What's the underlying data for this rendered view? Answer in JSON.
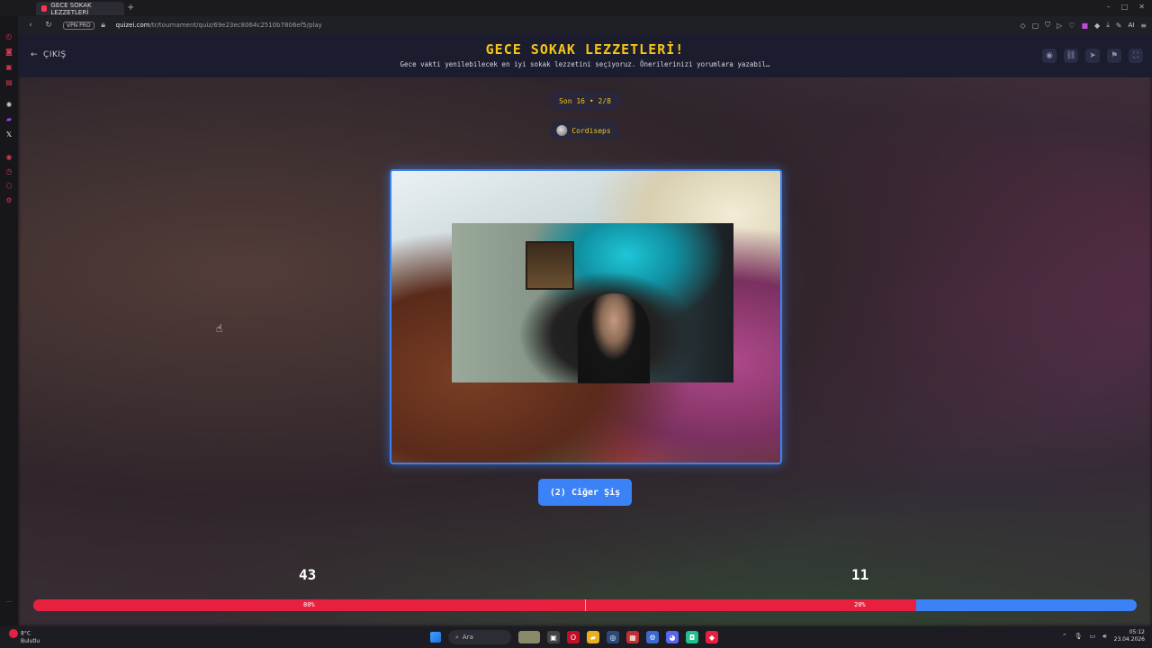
{
  "browser": {
    "tab_title": "GECE SOKAK LEZZETLERİ",
    "new_tab": "+",
    "vpn_badge": "VPN PRO",
    "url_host": "quizei.com",
    "url_path": "/tr/tournament/quiz/69e23ec8064c2510b7806ef5/play",
    "ai_label": "AI",
    "window_controls": [
      "–",
      "□",
      "✕"
    ]
  },
  "header": {
    "back_label": "ÇIKIŞ",
    "title": "GECE SOKAK LEZZETLERİ!",
    "subtitle": "Gece vakti yenilebilecek en iyi sokak lezzetini seçiyoruz. Önerilerinizi yorumlara yazabil…",
    "actions": [
      "eye-icon",
      "link-icon",
      "send-icon",
      "flag-icon",
      "fullscreen-icon"
    ]
  },
  "round": {
    "label": "Son 16 • 2/8"
  },
  "author": {
    "name": "Cordiseps"
  },
  "choice": {
    "label": "(2) Ciğer Şiş"
  },
  "votes": {
    "left_count": "43",
    "right_count": "11",
    "left_percent": "80%",
    "right_percent": "20%",
    "left_fraction": 0.8
  },
  "colors": {
    "accent_blue": "#3b82f6",
    "accent_red": "#e8203f",
    "title_yellow": "#f5c518",
    "header_bg": "#1b1c2e"
  },
  "taskbar": {
    "weather_temp": "8°C",
    "weather_desc": "Bulutlu",
    "search_label": "Ara",
    "time": "05:12",
    "date": "23.04.2026"
  }
}
